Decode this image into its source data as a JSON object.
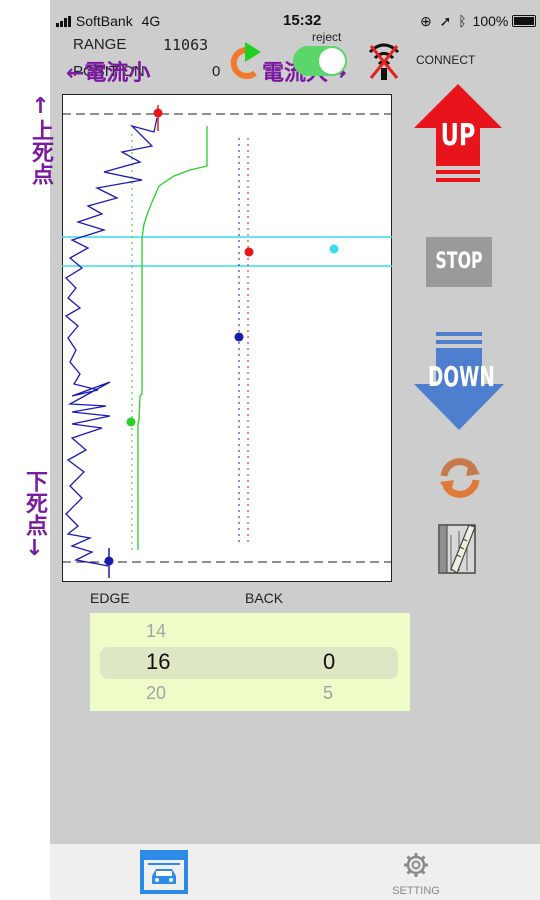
{
  "status_bar": {
    "carrier": "SoftBank",
    "network": "4G",
    "time": "15:32",
    "battery": "100%"
  },
  "header": {
    "range_label": "RANGE",
    "range_value": "11063",
    "position_label": "POSITION",
    "position_value": "0",
    "reject_label": "reject",
    "current_small": "←電流小",
    "current_large": "電流大→",
    "connect_label": "CONNECT",
    "reject_toggle_on": true
  },
  "side_labels": {
    "top_dead_center": "↑上死点",
    "bottom_dead_center": "下死点↓"
  },
  "plot": {
    "edge_label": "EDGE",
    "back_label": "BACK"
  },
  "controls": {
    "up_label": "UP",
    "stop_label": "STOP",
    "down_label": "DOWN"
  },
  "picker": {
    "col1": [
      "14",
      "16",
      "20"
    ],
    "col2": [
      "0",
      "5"
    ],
    "selected": {
      "col1": "16",
      "col2": "0"
    }
  },
  "tabs": [
    {
      "label": "",
      "icon": "garage-car-icon",
      "active": true
    },
    {
      "label": "SETTING",
      "icon": "gear-icon",
      "active": false
    }
  ],
  "colors": {
    "up_red": "#e8141b",
    "down_blue": "#4e7fcf",
    "active_tab": "#2b8be6",
    "trace_blue": "#1a1ab0",
    "trace_green": "#2ad02a",
    "band_cyan": "#39dcea",
    "marker_red": "#e81818",
    "purple_text": "#7a1aa0"
  }
}
